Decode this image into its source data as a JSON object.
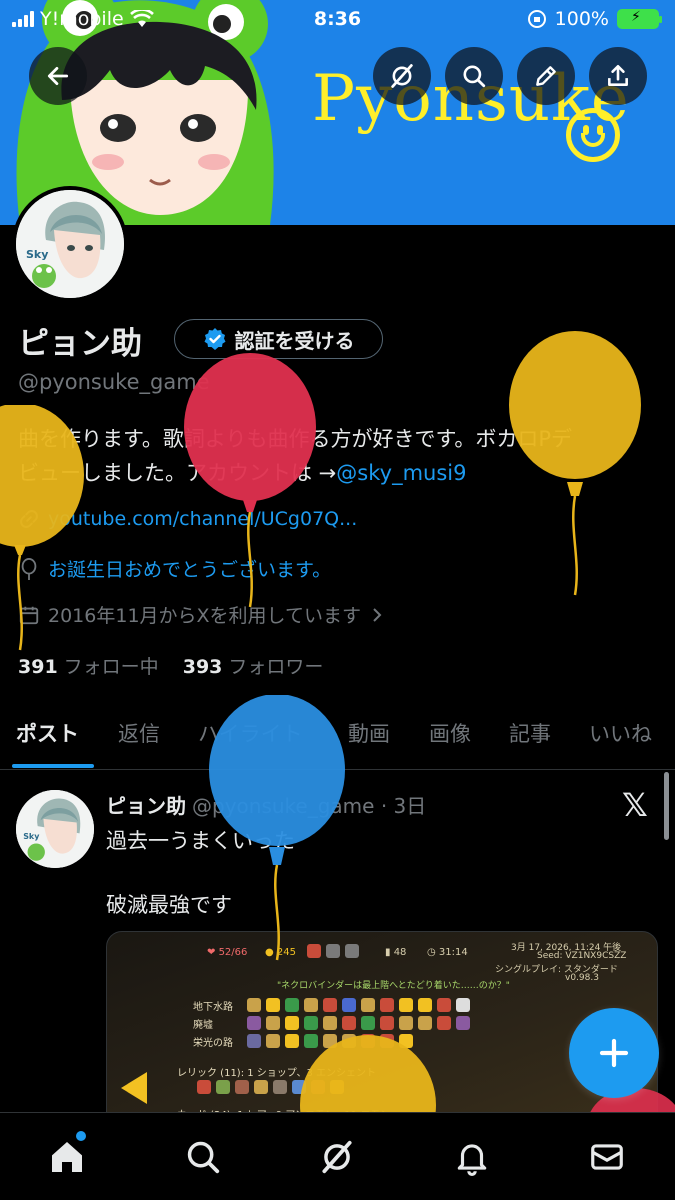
{
  "status_bar": {
    "carrier": "Y!mobile",
    "time": "8:36",
    "battery_percent": "100%"
  },
  "banner": {
    "script_text": "Pyonsuke"
  },
  "profile": {
    "name": "ピョン助",
    "verify_button_label": "認証を受ける",
    "handle": "@pyonsuke_game",
    "bio_line1": "曲を作ります。歌詞よりも曲作る方が好きです。ボカロPデ",
    "bio_line2_text": "ビューしました。アカウントは →",
    "bio_mention": "@sky_musi9",
    "link": "youtube.com/channel/UCg07Q...",
    "birthday": "お誕生日おめでとうございます。",
    "joined": "2016年11月からXを利用しています",
    "following_count": "391",
    "following_label": "フォロー中",
    "followers_count": "393",
    "followers_label": "フォロワー"
  },
  "tabs": [
    {
      "label": "ポスト",
      "active": true
    },
    {
      "label": "返信",
      "active": false
    },
    {
      "label": "ハイライト",
      "active": false
    },
    {
      "label": "動画",
      "active": false
    },
    {
      "label": "画像",
      "active": false
    },
    {
      "label": "記事",
      "active": false
    },
    {
      "label": "いいね",
      "active": false
    }
  ],
  "post": {
    "author_name": "ピョン助",
    "author_handle": "@pyonsuke_game",
    "time": "· 3日",
    "line1": "過去一うまくいった",
    "line2": "破滅最強です",
    "media": {
      "hp": "52/66",
      "gold": "245",
      "count": "48",
      "timer": "31:14",
      "date": "3月 17, 2026, 11:24 午後",
      "seed": "Seed: VZ1NX9CSZZ",
      "mode": "シングルプレイ: スタンダード",
      "version": "v0.98.3",
      "quote": "\"ネクロバインダーは最上階へとたどり着いた……のか？\"",
      "row1": "地下水路",
      "row2": "廃墟",
      "row3": "栄光の路",
      "relic_label": "レリック (11): 1 ショップ、3 エンシェント",
      "card_label": "カード (24): 1 レア、9 アンコモン、11 コモン"
    }
  },
  "colors": {
    "accent": "#1d9bf0",
    "banner": "#1d83e8",
    "banner_text": "#ffef2a",
    "background": "#000000",
    "balloon_red": "#e0304f",
    "balloon_yellow": "#e8b51a",
    "balloon_blue": "#2a8ee0"
  },
  "icons": {
    "back": "back-arrow-icon",
    "grok": "grok-icon",
    "search": "search-icon",
    "edit": "pencil-icon",
    "share": "share-icon",
    "link": "link-icon",
    "balloon": "balloon-icon",
    "calendar": "calendar-icon",
    "compose": "plus-icon",
    "home": "home-icon",
    "notifications": "bell-icon",
    "messages": "mail-icon"
  }
}
